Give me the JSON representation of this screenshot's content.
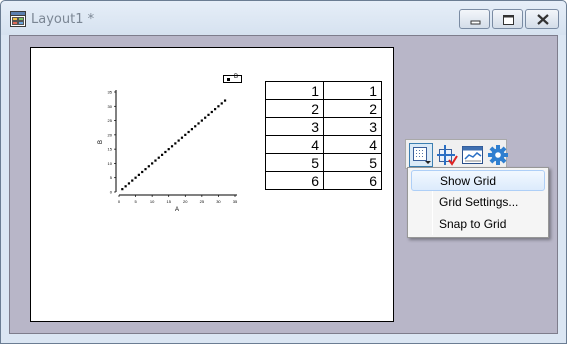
{
  "window": {
    "title": "Layout1 *",
    "controls": [
      "minimize",
      "maximize",
      "close"
    ]
  },
  "graph": {
    "chart_data": {
      "type": "scatter",
      "x": [
        1,
        2,
        3,
        4,
        5,
        6,
        7,
        8,
        9,
        10,
        11,
        12,
        13,
        14,
        15,
        16,
        17,
        18,
        19,
        20,
        21,
        22,
        23,
        24,
        25,
        26,
        27,
        28,
        29,
        30,
        31,
        32
      ],
      "y": [
        1,
        2,
        3,
        4,
        5,
        6,
        7,
        8,
        9,
        10,
        11,
        12,
        13,
        14,
        15,
        16,
        17,
        18,
        19,
        20,
        21,
        22,
        23,
        24,
        25,
        26,
        27,
        28,
        29,
        30,
        31,
        32
      ],
      "xlabel": "A",
      "ylabel": "B",
      "xlim": [
        0,
        35
      ],
      "ylim": [
        0,
        35
      ],
      "xticks": [
        "0",
        "5",
        "10",
        "15",
        "20",
        "25",
        "30",
        "35"
      ],
      "yticks": [
        "0",
        "5",
        "10",
        "15",
        "20",
        "25",
        "30",
        "35"
      ],
      "legend": {
        "label": "B",
        "placement": "top-right"
      },
      "grid": false
    }
  },
  "table": {
    "rows": [
      [
        "1",
        "1"
      ],
      [
        "2",
        "2"
      ],
      [
        "3",
        "3"
      ],
      [
        "4",
        "4"
      ],
      [
        "5",
        "5"
      ],
      [
        "6",
        "6"
      ]
    ]
  },
  "toolbar": {
    "buttons": [
      "grid-icon",
      "snap-icon",
      "layout-icon",
      "gear-icon"
    ]
  },
  "menu": {
    "items": [
      {
        "label": "Show Grid"
      },
      {
        "label": "Grid Settings..."
      },
      {
        "label": "Snap to Grid"
      }
    ]
  },
  "colors": {
    "workspace": "#b8b6c8",
    "gear": "#2f7fd0",
    "menu_highlight": "#dcebfc"
  }
}
